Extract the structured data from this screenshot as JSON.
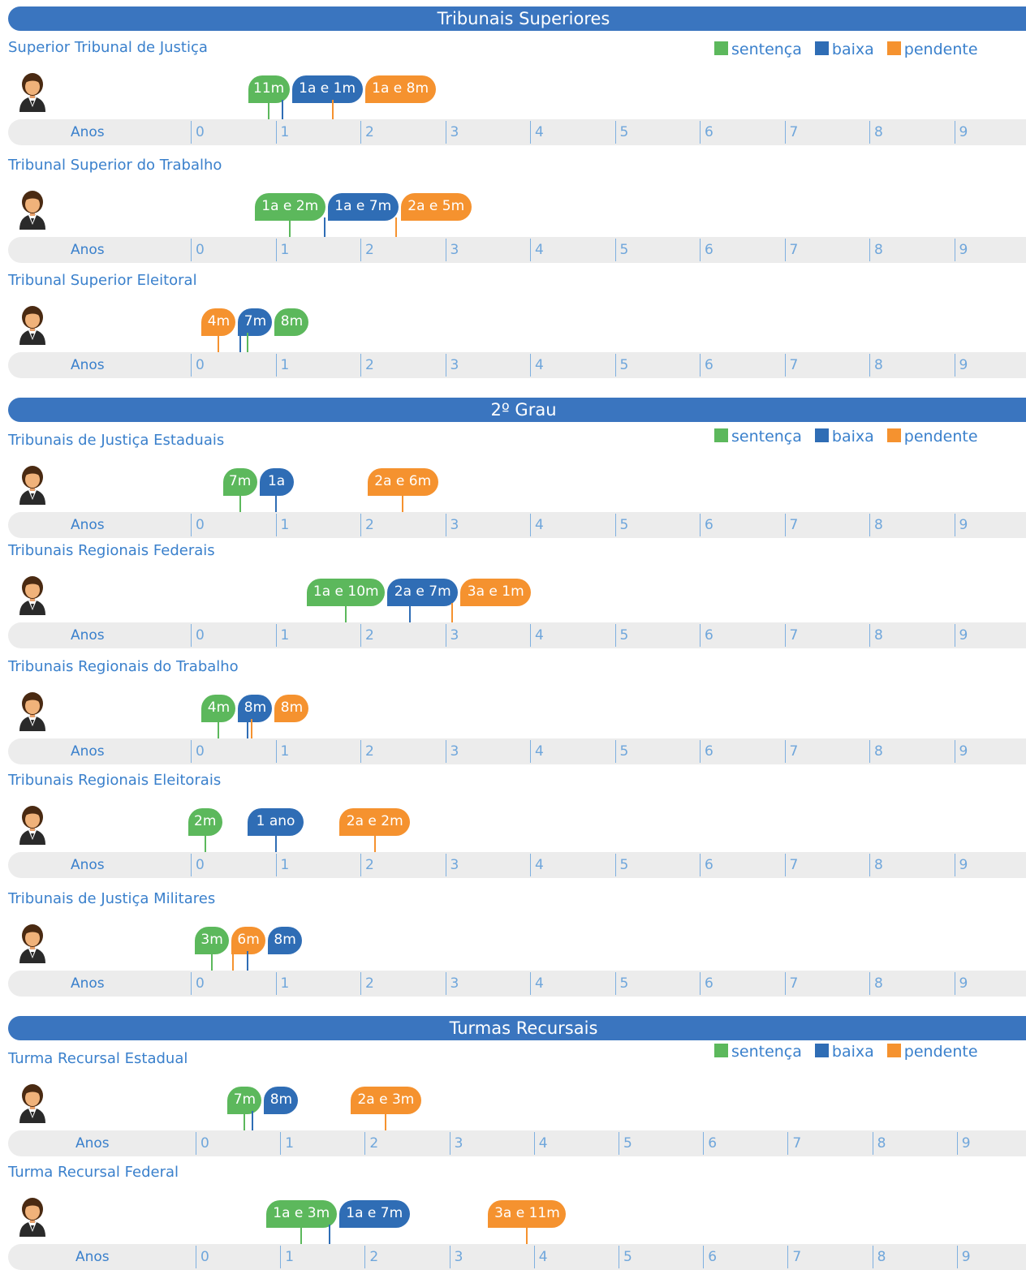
{
  "legend": {
    "sentenca": "sentença",
    "baixa": "baixa",
    "pendente": "pendente"
  },
  "colors": {
    "sentenca": "#5cb85c",
    "baixa": "#2f6db5",
    "pendente": "#f5922f",
    "section": "#3a75bf",
    "text": "#3a80cc"
  },
  "axis": {
    "label": "Anos",
    "ticks": [
      "0",
      "1",
      "2",
      "3",
      "4",
      "5",
      "6",
      "7",
      "8",
      "9"
    ]
  },
  "sections": [
    {
      "title": "Tribunais Superiores"
    },
    {
      "title": "2º Grau"
    },
    {
      "title": "Turmas Recursais"
    }
  ],
  "chart_data": {
    "type": "timeline",
    "xlabel": "Anos",
    "xlim": [
      0,
      9
    ],
    "series": [
      {
        "name": "sentença"
      },
      {
        "name": "baixa"
      },
      {
        "name": "pendente"
      }
    ],
    "courts": [
      {
        "section": 0,
        "name": "Superior Tribunal de Justiça",
        "items": [
          {
            "type": "sentenca",
            "label": "11m",
            "years": 0.92
          },
          {
            "type": "baixa",
            "label": "1a e 1m",
            "years": 1.08
          },
          {
            "type": "pendente",
            "label": "1a e 8m",
            "years": 1.67
          }
        ]
      },
      {
        "section": 0,
        "name": "Tribunal Superior do Trabalho",
        "items": [
          {
            "type": "sentenca",
            "label": "1a e 2m",
            "years": 1.17
          },
          {
            "type": "baixa",
            "label": "1a e 7m",
            "years": 1.58
          },
          {
            "type": "pendente",
            "label": "2a e 5m",
            "years": 2.42
          }
        ]
      },
      {
        "section": 0,
        "name": "Tribunal Superior Eleitoral",
        "items": [
          {
            "type": "pendente",
            "label": "4m",
            "years": 0.33
          },
          {
            "type": "baixa",
            "label": "7m",
            "years": 0.58
          },
          {
            "type": "sentenca",
            "label": "8m",
            "years": 0.67
          }
        ]
      },
      {
        "section": 1,
        "name": "Tribunais de Justiça Estaduais",
        "items": [
          {
            "type": "sentenca",
            "label": "7m",
            "years": 0.58
          },
          {
            "type": "baixa",
            "label": "1a",
            "years": 1.0
          },
          {
            "type": "pendente",
            "label": "2a e 6m",
            "years": 2.5
          }
        ]
      },
      {
        "section": 1,
        "name": "Tribunais Regionais Federais",
        "items": [
          {
            "type": "sentenca",
            "label": "1a e 10m",
            "years": 1.83
          },
          {
            "type": "baixa",
            "label": "2a e 7m",
            "years": 2.58
          },
          {
            "type": "pendente",
            "label": "3a e 1m",
            "years": 3.08
          }
        ]
      },
      {
        "section": 1,
        "name": "Tribunais Regionais do Trabalho",
        "items": [
          {
            "type": "sentenca",
            "label": "4m",
            "years": 0.33
          },
          {
            "type": "baixa",
            "label": "8m",
            "years": 0.67
          },
          {
            "type": "pendente",
            "label": "8m",
            "years": 0.72
          }
        ]
      },
      {
        "section": 1,
        "name": "Tribunais Regionais Eleitorais",
        "items": [
          {
            "type": "sentenca",
            "label": "2m",
            "years": 0.17
          },
          {
            "type": "baixa",
            "label": "1 ano",
            "years": 1.0
          },
          {
            "type": "pendente",
            "label": "2a e 2m",
            "years": 2.17
          }
        ]
      },
      {
        "section": 1,
        "name": "Tribunais de Justiça Militares",
        "items": [
          {
            "type": "sentenca",
            "label": "3m",
            "years": 0.25
          },
          {
            "type": "pendente",
            "label": "6m",
            "years": 0.5
          },
          {
            "type": "baixa",
            "label": "8m",
            "years": 0.67
          }
        ]
      },
      {
        "section": 2,
        "name": "Turma Recursal Estadual",
        "items": [
          {
            "type": "sentenca",
            "label": "7m",
            "years": 0.58
          },
          {
            "type": "baixa",
            "label": "8m",
            "years": 0.67
          },
          {
            "type": "pendente",
            "label": "2a e 3m",
            "years": 2.25
          }
        ]
      },
      {
        "section": 2,
        "name": "Turma Recursal Federal",
        "items": [
          {
            "type": "sentenca",
            "label": "1a e 3m",
            "years": 1.25
          },
          {
            "type": "baixa",
            "label": "1a e 7m",
            "years": 1.58
          },
          {
            "type": "pendente",
            "label": "3a e 11m",
            "years": 3.92
          }
        ]
      }
    ]
  }
}
